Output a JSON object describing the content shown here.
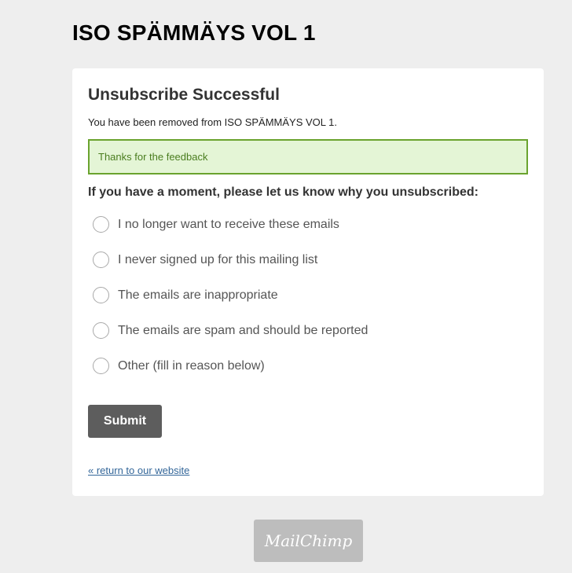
{
  "list_title": "ISO SPÄMMÄYS VOL 1",
  "card": {
    "title": "Unsubscribe Successful",
    "removed_message": "You have been removed from ISO SPÄMMÄYS VOL 1.",
    "feedback_alert": "Thanks for the feedback",
    "question": "If you have a moment, please let us know why you unsubscribed:",
    "options": [
      "I no longer want to receive these emails",
      "I never signed up for this mailing list",
      "The emails are inappropriate",
      "The emails are spam and should be reported",
      "Other (fill in reason below)"
    ],
    "submit_label": "Submit",
    "return_link": "« return to our website"
  },
  "footer": {
    "logo_text": "MailChimp"
  },
  "colors": {
    "background": "#eeeeee",
    "alert_background": "#e4f5d6",
    "alert_border": "#6aa32e",
    "button": "#5d5d5d",
    "link": "#336699"
  }
}
